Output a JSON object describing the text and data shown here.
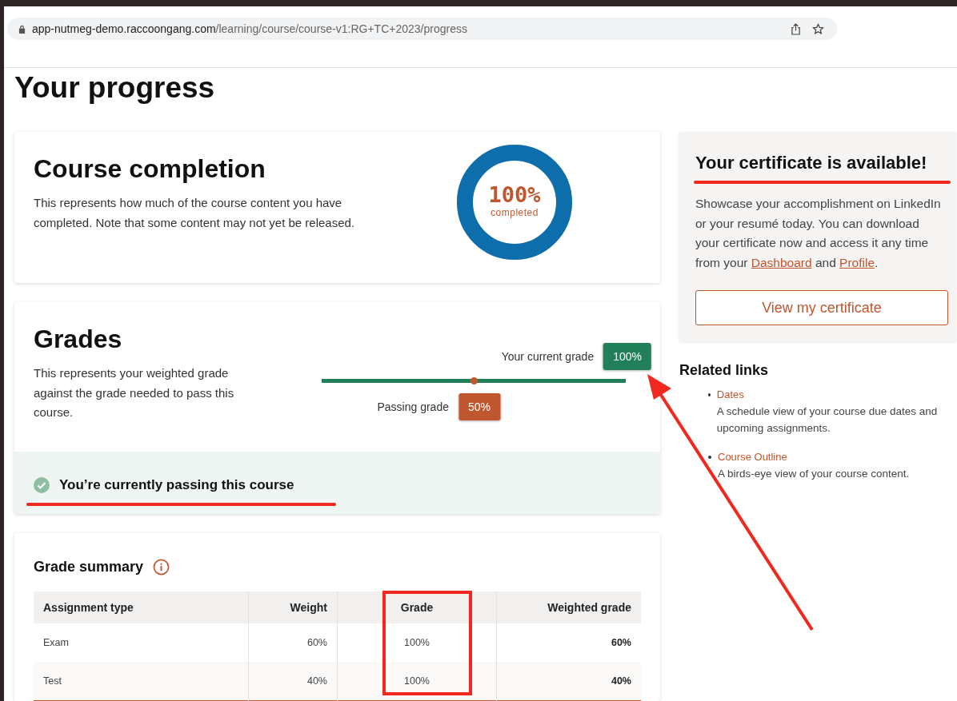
{
  "browser": {
    "url_host": "app-nutmeg-demo.raccoongang.com",
    "url_path": "/learning/course/course-v1:RG+TC+2023/progress"
  },
  "page_title": "Your progress",
  "completion": {
    "title": "Course completion",
    "description": "This represents how much of the course content you have completed. Note that some content may not yet be released.",
    "percent": "100%",
    "caption": "completed",
    "level": 1
  },
  "grades": {
    "title": "Grades",
    "description": "This represents your weighted grade against the grade needed to pass this course.",
    "current": {
      "label": "Your current grade",
      "value": "100%",
      "level": 1
    },
    "passing_grade": {
      "label": "Passing grade",
      "value": "50%",
      "level": 0.5
    },
    "status": "You’re currently passing this course",
    "passing": true
  },
  "grade_summary": {
    "title": "Grade summary",
    "columns": [
      "Assignment type",
      "Weight",
      "Grade",
      "Weighted grade"
    ],
    "rows": [
      {
        "cells": [
          "Exam",
          "60%",
          "100%",
          "60%"
        ]
      },
      {
        "cells": [
          "Test",
          "40%",
          "100%",
          "40%"
        ]
      }
    ]
  },
  "certificate": {
    "title": "Your certificate is available!",
    "text": "Showcase your accomplishment on LinkedIn or your resumé today. You can download your certificate now and access it any time from your",
    "link_1": "Dashboard",
    "joiner": "and",
    "link_2": "Profile",
    "end": ".",
    "button": "View my certificate"
  },
  "related_links": {
    "title": "Related links",
    "items": [
      {
        "link": "Dates",
        "description": "A schedule view of your course due dates and upcoming assignments."
      },
      {
        "link": "Course Outline",
        "description": "A birds-eye view of your course content."
      }
    ]
  },
  "annotations": [
    {
      "kind": "underline"
    },
    {
      "kind": "underline"
    },
    {
      "kind": "box"
    },
    {
      "kind": "arrow"
    }
  ]
}
